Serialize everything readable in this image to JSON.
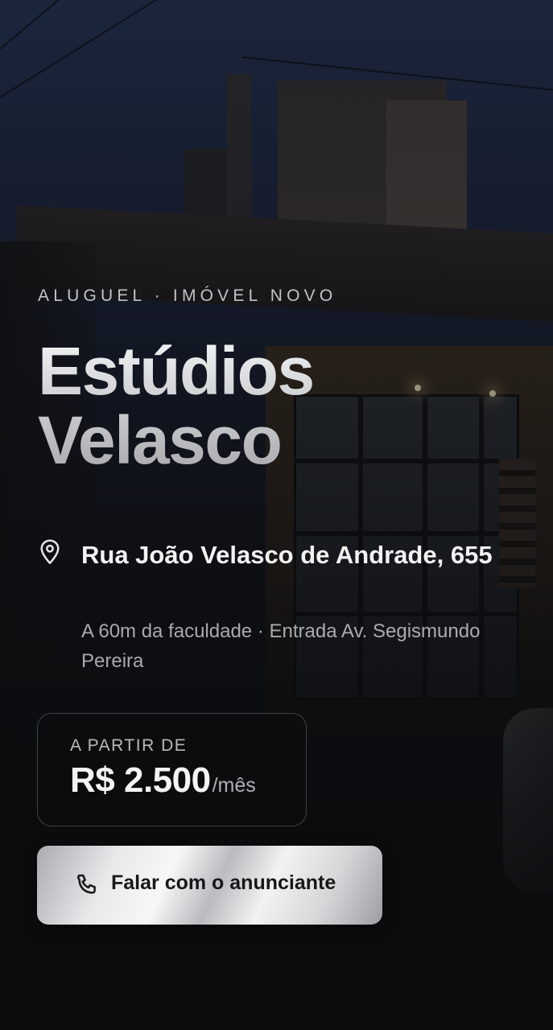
{
  "listing": {
    "eyebrow": "ALUGUEL · IMÓVEL NOVO",
    "title_line_1": "Estúdios",
    "title_line_2": "Velasco",
    "address": "Rua João Velasco de Andrade, 655",
    "address_detail": "A 60m da faculdade · Entrada Av. Segismundo Pereira"
  },
  "price": {
    "label": "A PARTIR DE",
    "amount": "R$ 2.500",
    "unit": "/mês"
  },
  "cta": {
    "label": "Falar com o anunciante",
    "icon": "phone-icon"
  },
  "icons": {
    "address": "map-pin-icon"
  },
  "colors": {
    "background": "#0b0c0e",
    "cta_silver": "#e8e9eb",
    "text_primary": "#f2f2f3"
  }
}
